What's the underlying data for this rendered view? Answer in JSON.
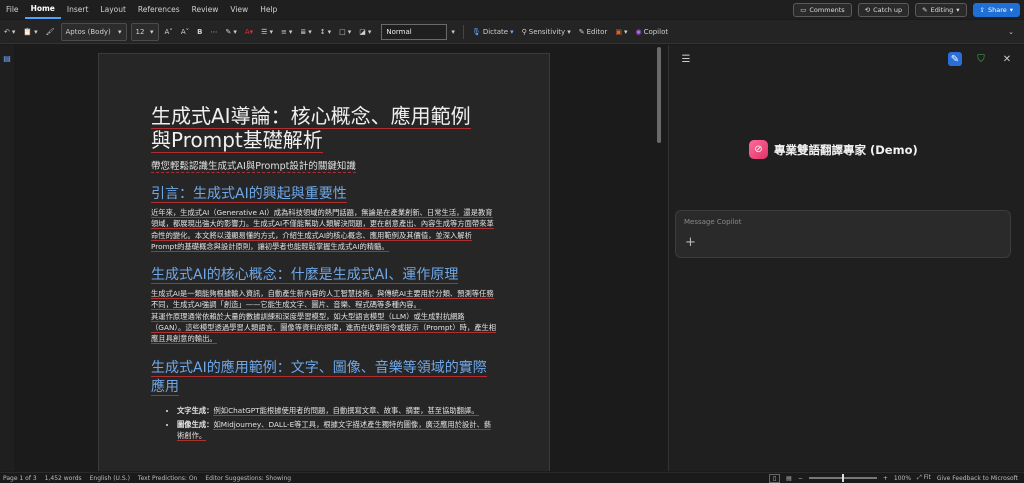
{
  "menu": {
    "tabs": [
      "File",
      "Home",
      "Insert",
      "Layout",
      "References",
      "Review",
      "View",
      "Help"
    ],
    "active": "Home",
    "comments": "Comments",
    "catchup": "Catch up",
    "editing": "Editing",
    "share": "Share"
  },
  "ribbon": {
    "font": "Aptos (Body)",
    "size": "12",
    "style": "Normal",
    "dictate": "Dictate",
    "sensitivity": "Sensitivity",
    "editor": "Editor",
    "copilot": "Copilot"
  },
  "doc": {
    "title": "生成式AI導論：核心概念、應用範例與Prompt基礎解析",
    "subtitle": "帶您輕鬆認識生成式AI與Prompt設計的關鍵知識",
    "s1_heading": "引言：生成式AI的興起與重要性",
    "s1_body": "近年來，生成式AI（Generative AI）成為科技領域的熱門話題，無論是在產業創新、日常生活，還是教育領域，都展現出強大的影響力。生成式AI不僅能幫助人類解決問題，更在創意產出、內容生成等方面帶來革命性的變化。本文將以淺顯易懂的方式，介紹生成式AI的核心概念、應用範例及其價值，並深入解析Prompt的基礎概念與設計原則，讓初學者也能輕鬆掌握生成式AI的精髓。",
    "s2_heading": "生成式AI的核心概念：什麼是生成式AI、運作原理",
    "s2_body1": "生成式AI是一類能夠根據輸入資訊，自動產生新內容的人工智慧技術。與傳統AI主要用於分類、預測等任務不同，生成式AI強調「創造」——它能生成文字、圖片、音樂、程式碼等多種內容。",
    "s2_body2": "其運作原理通常依賴於大量的數據訓練和深度學習模型，如大型語言模型（LLM）或生成對抗網路（GAN）。這些模型透過學習人類語言、圖像等資料的規律，進而在收到指令或提示（Prompt）時，產生相應且具創意的輸出。",
    "s3_heading": "生成式AI的應用範例：文字、圖像、音樂等領域的實際應用",
    "bullets": [
      {
        "label": "文字生成：",
        "text": "例如ChatGPT能根據使用者的問題，自動撰寫文章、故事、摘要，甚至協助翻譯。"
      },
      {
        "label": "圖像生成：",
        "text": "如Midjourney、DALL-E等工具，根據文字描述產生獨特的圖像，廣泛應用於設計、藝術創作。"
      }
    ]
  },
  "copilot": {
    "agent_name": "專業雙語翻譯專家 (Demo)",
    "placeholder": "Message Copilot"
  },
  "status": {
    "page": "Page 1 of 3",
    "words": "1,452 words",
    "language": "English (U.S.)",
    "predictions": "Text Predictions: On",
    "editor": "Editor Suggestions: Showing",
    "zoom": "100%",
    "fit": "Fit",
    "feedback": "Give Feedback to Microsoft"
  },
  "colors": {
    "accent": "#1f6fd6",
    "heading": "#6fa8e8",
    "spell": "#b03030"
  }
}
